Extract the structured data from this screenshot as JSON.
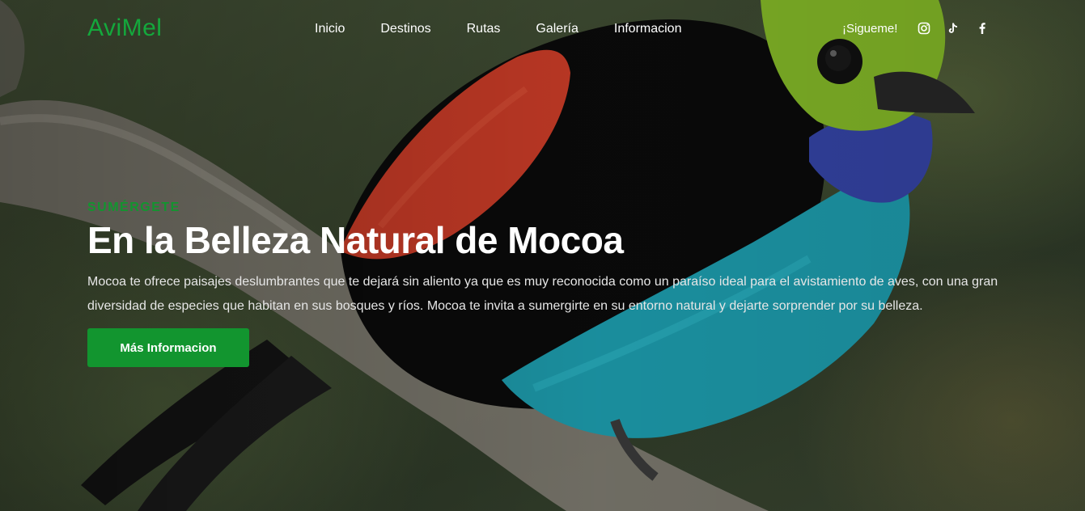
{
  "brand": {
    "logo_text": "AviMel",
    "accent_color": "#12952f"
  },
  "nav": {
    "items": [
      {
        "label": "Inicio"
      },
      {
        "label": "Destinos"
      },
      {
        "label": "Rutas"
      },
      {
        "label": "Galería"
      },
      {
        "label": "Informacion"
      }
    ]
  },
  "social": {
    "label": "¡Sigueme!",
    "icons": [
      "instagram-icon",
      "tiktok-icon",
      "facebook-icon"
    ]
  },
  "hero": {
    "eyebrow": "SUMÉRGETE",
    "title": "En la Belleza Natural de Mocoa",
    "description": "Mocoa te ofrece paisajes deslumbrantes que te dejará sin aliento ya que es muy reconocida como un paraíso ideal para el avistamiento de aves, con una gran diversidad de especies que habitan en sus bosques y ríos. Mocoa te invita a sumergirte en su entorno natural y dejarte sorprender por su belleza.",
    "cta_label": "Más Informacion"
  }
}
